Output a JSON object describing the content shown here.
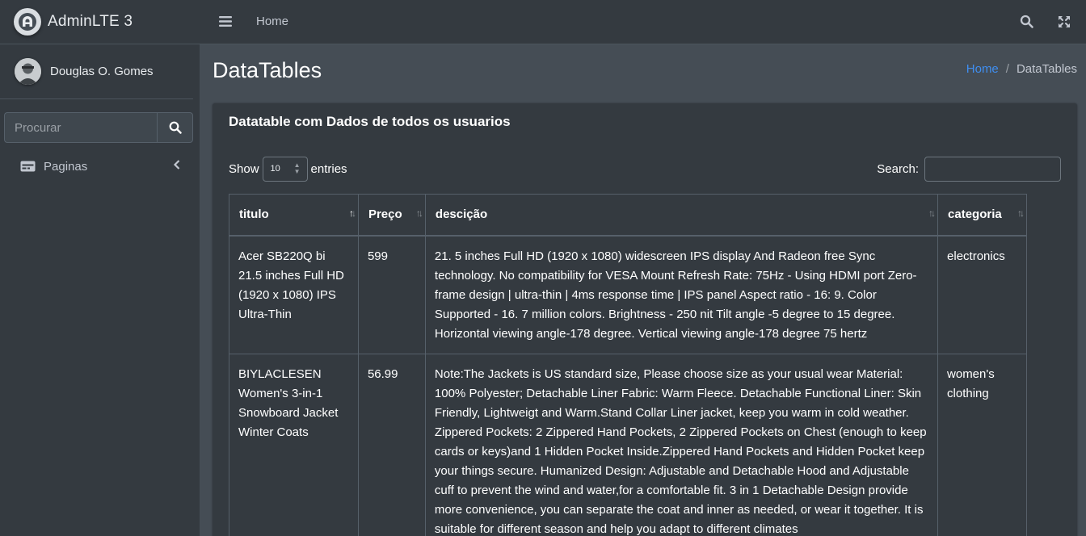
{
  "sidebar": {
    "brand": "AdminLTE 3",
    "user_name": "Douglas O. Gomes",
    "search_placeholder": "Procurar",
    "nav_items": [
      {
        "label": "Paginas",
        "icon": "pages-icon"
      }
    ]
  },
  "navbar": {
    "home_label": "Home"
  },
  "page": {
    "title": "DataTables",
    "breadcrumb": {
      "home": "Home",
      "separator": "/",
      "current": "DataTables"
    }
  },
  "card": {
    "title": "Datatable com Dados de todos os usuarios",
    "show_label": "Show",
    "entries_label": "entries",
    "page_length": "10",
    "search_label": "Search:",
    "columns": [
      "titulo",
      "Preço",
      "descição",
      "categoria"
    ],
    "rows": [
      {
        "titulo": "Acer SB220Q bi 21.5 inches Full HD (1920 x 1080) IPS Ultra-Thin",
        "preco": "599",
        "descricao": "21. 5 inches Full HD (1920 x 1080) widescreen IPS display And Radeon free Sync technology. No compatibility for VESA Mount Refresh Rate: 75Hz - Using HDMI port Zero-frame design | ultra-thin | 4ms response time | IPS panel Aspect ratio - 16: 9. Color Supported - 16. 7 million colors. Brightness - 250 nit Tilt angle -5 degree to 15 degree. Horizontal viewing angle-178 degree. Vertical viewing angle-178 degree 75 hertz",
        "categoria": "electronics"
      },
      {
        "titulo": "BIYLACLESEN Women's 3-in-1 Snowboard Jacket Winter Coats",
        "preco": "56.99",
        "descricao": "Note:The Jackets is US standard size, Please choose size as your usual wear Material: 100% Polyester; Detachable Liner Fabric: Warm Fleece. Detachable Functional Liner: Skin Friendly, Lightweigt and Warm.Stand Collar Liner jacket, keep you warm in cold weather. Zippered Pockets: 2 Zippered Hand Pockets, 2 Zippered Pockets on Chest (enough to keep cards or keys)and 1 Hidden Pocket Inside.Zippered Hand Pockets and Hidden Pocket keep your things secure. Humanized Design: Adjustable and Detachable Hood and Adjustable cuff to prevent the wind and water,for a comfortable fit. 3 in 1 Detachable Design provide more convenience, you can separate the coat and inner as needed, or wear it together. It is suitable for different season and help you adapt to different climates",
        "categoria": "women's clothing"
      }
    ]
  },
  "colors": {
    "sidebar_bg": "#343a40",
    "content_bg": "#454d55",
    "card_bg": "#343a40",
    "link": "#3f8ef0"
  }
}
